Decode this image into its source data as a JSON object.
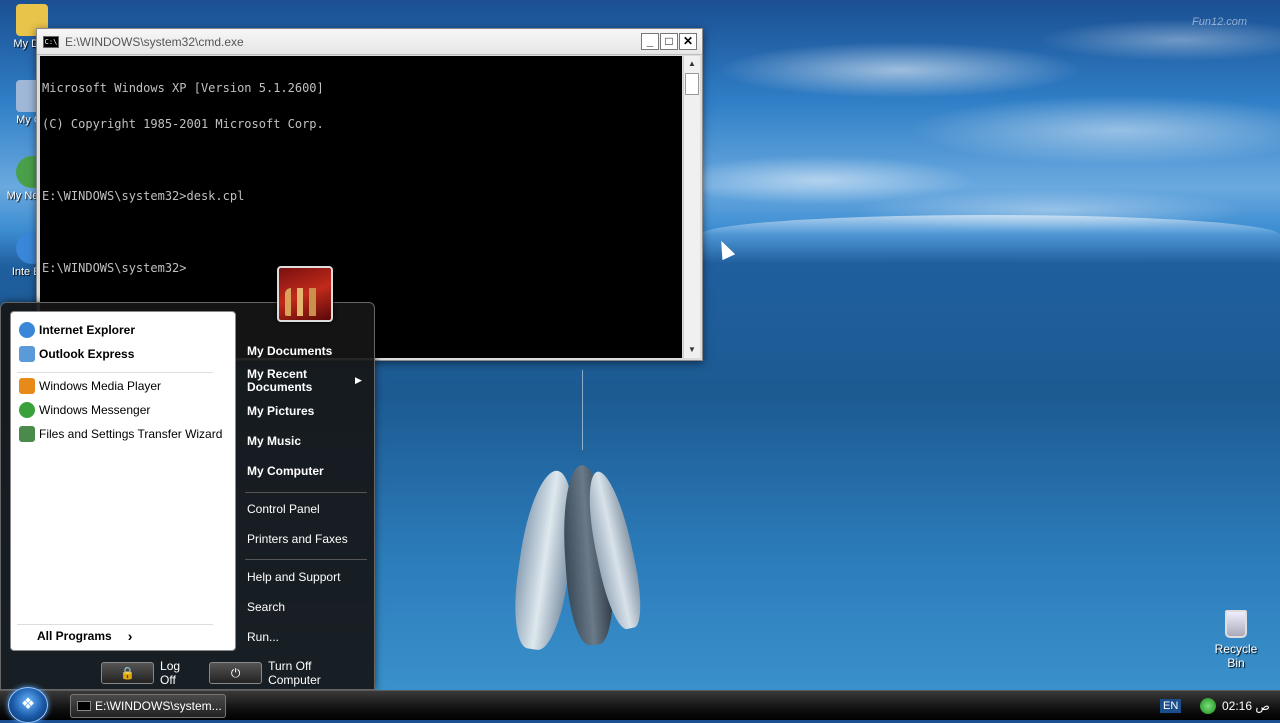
{
  "watermark": "Fun12.com",
  "desktop_icons": [
    {
      "label": "My Doc",
      "icon": "folder-icon",
      "color": "#e8c44a"
    },
    {
      "label": "My Co",
      "icon": "computer-icon",
      "color": "#9fb8d8"
    },
    {
      "label": "My Ne Pla",
      "icon": "network-icon",
      "color": "#4aa04a"
    },
    {
      "label": "Inte Exp",
      "icon": "ie-icon",
      "color": "#3a86d8"
    }
  ],
  "cmd": {
    "title": "E:\\WINDOWS\\system32\\cmd.exe",
    "app_icon": "C:\\",
    "min": "_",
    "max": "□",
    "close": "✕",
    "lines": [
      "Microsoft Windows XP [Version 5.1.2600]",
      "(C) Copyright 1985-2001 Microsoft Corp.",
      "",
      "E:\\WINDOWS\\system32>desk.cpl",
      "",
      "E:\\WINDOWS\\system32>"
    ]
  },
  "start_menu": {
    "pinned": [
      {
        "label": "Internet Explorer",
        "icon": "ie-icon",
        "color": "#3a86d8"
      },
      {
        "label": "Outlook Express",
        "icon": "outlook-icon",
        "color": "#5a9ad8"
      }
    ],
    "recent": [
      {
        "label": "Windows Media Player",
        "icon": "media-player-icon",
        "color": "#e88a1a"
      },
      {
        "label": "Windows Messenger",
        "icon": "messenger-icon",
        "color": "#3aa03a"
      },
      {
        "label": "Files and Settings Transfer Wizard",
        "icon": "transfer-wizard-icon",
        "color": "#4a8a4a"
      }
    ],
    "all_programs": "All Programs",
    "all_programs_arrow": "›",
    "right_top": [
      "My Documents",
      "My Recent Documents",
      "My Pictures",
      "My Music",
      "My Computer"
    ],
    "right_mid": [
      "Control Panel",
      "Printers and Faxes"
    ],
    "right_bottom": [
      "Help and Support",
      "Search",
      "Run..."
    ],
    "submenu_arrow": "▶",
    "log_off": "Log Off",
    "turn_off": "Turn Off Computer"
  },
  "taskbar": {
    "task_label": "E:\\WINDOWS\\system...",
    "lang": "EN",
    "time": "02:16 ص"
  },
  "recycle_bin": "Recycle Bin"
}
